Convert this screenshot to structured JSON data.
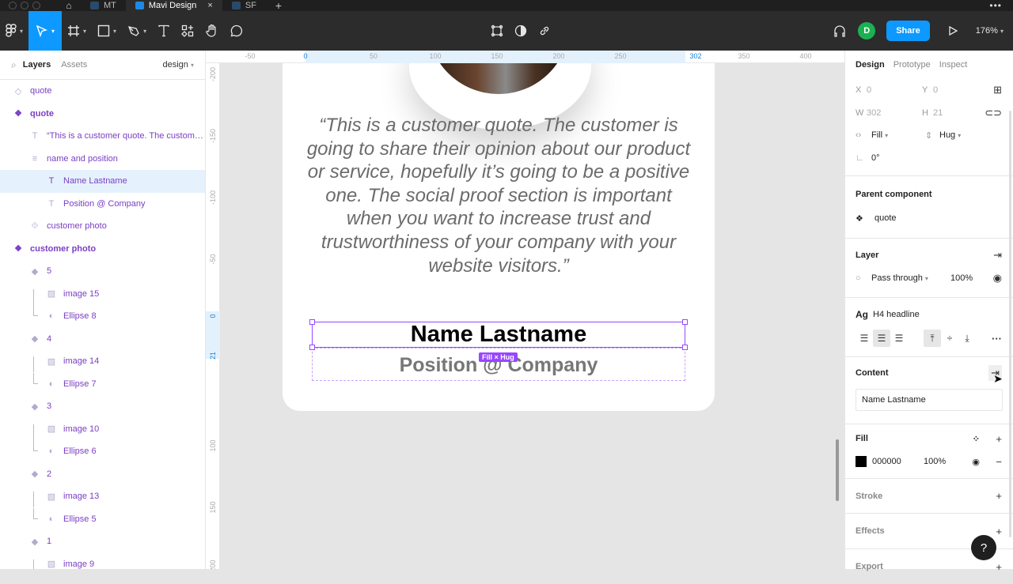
{
  "tabbar": {
    "tabs": [
      {
        "label": "MT",
        "active": false
      },
      {
        "label": "Mavi Design",
        "active": true
      },
      {
        "label": "SF",
        "active": false
      }
    ],
    "close_glyph": "×",
    "new_tab_glyph": "+",
    "more_glyph": "•••"
  },
  "toolbar": {
    "tools": [
      "main-menu",
      "move",
      "frame",
      "shape",
      "pen",
      "text",
      "resources",
      "hand",
      "comment"
    ],
    "active_tool": "move",
    "center_tools": [
      "component-edit",
      "contrast",
      "link"
    ],
    "avatar_initial": "D",
    "share_label": "Share",
    "zoom_level": "176%",
    "accent": "#0d99ff"
  },
  "left_panel": {
    "tabs": {
      "layers": "Layers",
      "assets": "Assets"
    },
    "page": "design",
    "layers": [
      {
        "label": "quote",
        "icon": "component-outline",
        "indent": 0,
        "bold": false
      },
      {
        "label": "quote",
        "icon": "component",
        "indent": 0,
        "bold": true
      },
      {
        "label": "“This is a customer quote. The custome...",
        "icon": "text",
        "indent": 1
      },
      {
        "label": "name and position",
        "icon": "autolayout",
        "indent": 1
      },
      {
        "label": "Name Lastname",
        "icon": "text",
        "indent": 2,
        "selected": true
      },
      {
        "label": "Position @ Company",
        "icon": "text",
        "indent": 2
      },
      {
        "label": "customer photo",
        "icon": "instance-frame",
        "indent": 1
      },
      {
        "label": "customer photo",
        "icon": "component",
        "indent": 0,
        "bold": true
      },
      {
        "label": "5",
        "icon": "diamond",
        "indent": 1
      },
      {
        "label": "image 15",
        "icon": "image",
        "indent": 2,
        "connector": "top"
      },
      {
        "label": "Ellipse 8",
        "icon": "ellipse",
        "indent": 2,
        "connector": "bottom"
      },
      {
        "label": "4",
        "icon": "diamond",
        "indent": 1
      },
      {
        "label": "image 14",
        "icon": "image",
        "indent": 2,
        "connector": "top"
      },
      {
        "label": "Ellipse 7",
        "icon": "ellipse",
        "indent": 2,
        "connector": "bottom"
      },
      {
        "label": "3",
        "icon": "diamond",
        "indent": 1
      },
      {
        "label": "image 10",
        "icon": "image",
        "indent": 2,
        "connector": "top"
      },
      {
        "label": "Ellipse 6",
        "icon": "ellipse",
        "indent": 2,
        "connector": "bottom"
      },
      {
        "label": "2",
        "icon": "diamond",
        "indent": 1
      },
      {
        "label": "image 13",
        "icon": "image",
        "indent": 2,
        "connector": "top"
      },
      {
        "label": "Ellipse 5",
        "icon": "ellipse",
        "indent": 2,
        "connector": "bottom"
      },
      {
        "label": "1",
        "icon": "diamond",
        "indent": 1
      },
      {
        "label": "image 9",
        "icon": "image",
        "indent": 2,
        "connector": "top"
      }
    ]
  },
  "canvas": {
    "ruler_top": [
      "-50",
      "0",
      "50",
      "100",
      "150",
      "200",
      "250",
      "302",
      "350",
      "400"
    ],
    "ruler_left": [
      "-200",
      "-150",
      "-100",
      "-50",
      "0",
      "21",
      "100",
      "150",
      "200"
    ],
    "quote": "“This is a customer quote. The customer is going to share their opinion about our product or service, hopefully it’s going to be a positive one. The social proof section is important when you want to increase trust and trustworthiness of your company with your website visitors.”",
    "name": "Name Lastname",
    "position": "Position @ Company",
    "size_badge": "Fill × Hug",
    "selection_color": "#9747ff"
  },
  "right_panel": {
    "tabs": [
      "Design",
      "Prototype",
      "Inspect"
    ],
    "active_tab": "Design",
    "x": {
      "label": "X",
      "value": "0"
    },
    "y": {
      "label": "Y",
      "value": "0"
    },
    "w": {
      "label": "W",
      "value": "302"
    },
    "h": {
      "label": "H",
      "value": "21"
    },
    "horizontal_resizing": "Fill",
    "vertical_resizing": "Hug",
    "rotation": "0°",
    "parent_component": {
      "title": "Parent component",
      "name": "quote"
    },
    "layer": {
      "title": "Layer",
      "blend": "Pass through",
      "opacity": "100%"
    },
    "text": {
      "style_prefix": "Ag",
      "style_name": "H4 headline"
    },
    "content": {
      "title": "Content",
      "value": "Name Lastname"
    },
    "fill": {
      "title": "Fill",
      "hex": "000000",
      "opacity": "100%",
      "color": "#000000"
    },
    "stroke": {
      "title": "Stroke"
    },
    "effects": {
      "title": "Effects"
    },
    "export": {
      "title": "Export"
    },
    "help": "?"
  }
}
